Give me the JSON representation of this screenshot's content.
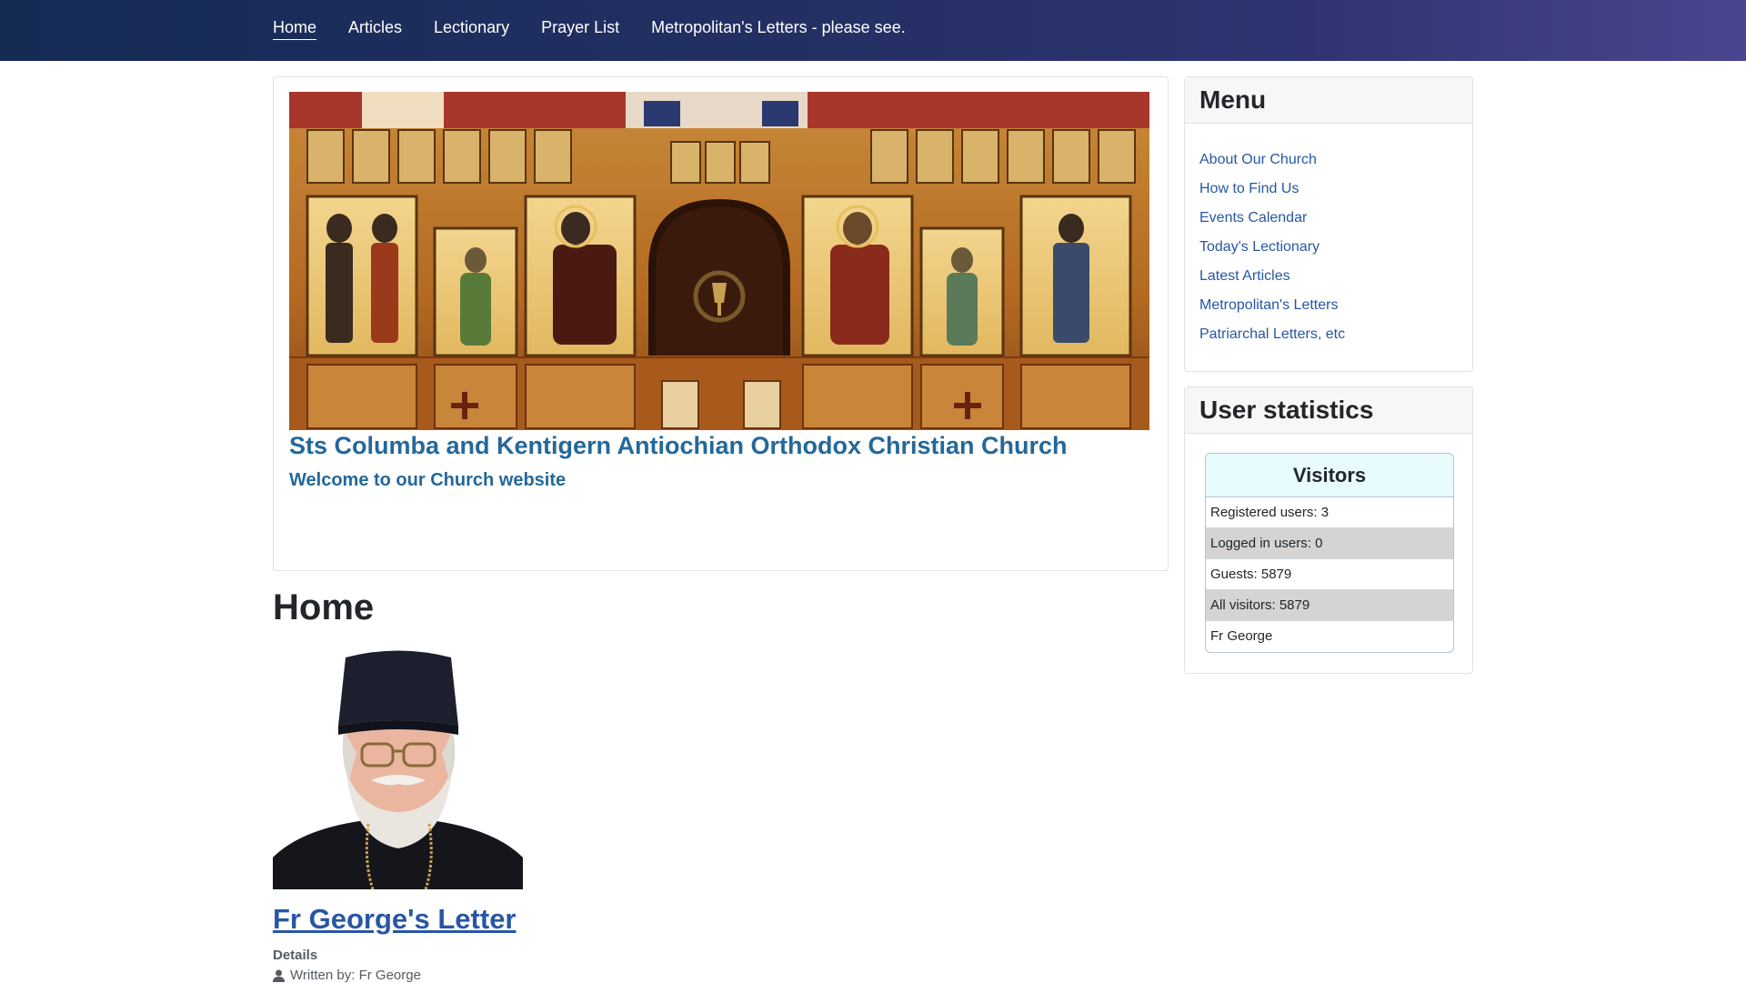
{
  "nav": {
    "items": [
      {
        "label": "Home",
        "active": true
      },
      {
        "label": "Articles",
        "active": false
      },
      {
        "label": "Lectionary",
        "active": false
      },
      {
        "label": "Prayer List",
        "active": false
      },
      {
        "label": "Metropolitan's Letters - please see.",
        "active": false
      }
    ]
  },
  "banner": {
    "title": "Sts Columba and Kentigern Antiochian Orthodox Christian Church",
    "subtitle": "Welcome to our Church website"
  },
  "main": {
    "heading": "Home",
    "article": {
      "title": "Fr George's Letter",
      "details_label": "Details",
      "written_by": "Written by: Fr George"
    }
  },
  "sidebar": {
    "menu": {
      "title": "Menu",
      "items": [
        "About Our Church",
        "How to Find Us",
        "Events Calendar",
        "Today's Lectionary",
        "Latest Articles",
        "Metropolitan's Letters",
        "Patriarchal Letters, etc"
      ]
    },
    "stats": {
      "title": "User statistics",
      "visitors_heading": "Visitors",
      "rows": [
        "Registered users: 3",
        "Logged in users: 0",
        "Guests: 5879",
        "All visitors: 5879",
        "Fr George"
      ]
    }
  },
  "colors": {
    "link": "#2856a3",
    "title_blue": "#24689b",
    "nav_bg_start": "#152b54",
    "nav_bg_end": "#4a4590"
  },
  "icons": {
    "author": "person-icon"
  }
}
